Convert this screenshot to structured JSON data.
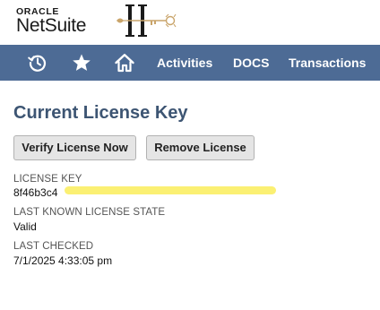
{
  "logo": {
    "oracle": "ORACLE",
    "netsuite": "NetSuite"
  },
  "nav": {
    "icons": [
      "recent-history-icon",
      "star-icon",
      "home-icon"
    ],
    "links": [
      "Activities",
      "DOCS",
      "Transactions"
    ]
  },
  "page": {
    "title": "Current License Key",
    "buttons": {
      "verify": "Verify License Now",
      "remove": "Remove License"
    },
    "fields": [
      {
        "label": "LICENSE KEY",
        "value": "8f46b3c4"
      },
      {
        "label": "LAST KNOWN LICENSE STATE",
        "value": "Valid"
      },
      {
        "label": "LAST CHECKED",
        "value": "7/1/2025 4:33:05 pm"
      }
    ]
  },
  "colors": {
    "navbar": "#4d6b95",
    "title": "#3d5573",
    "highlight": "#fbf073"
  }
}
